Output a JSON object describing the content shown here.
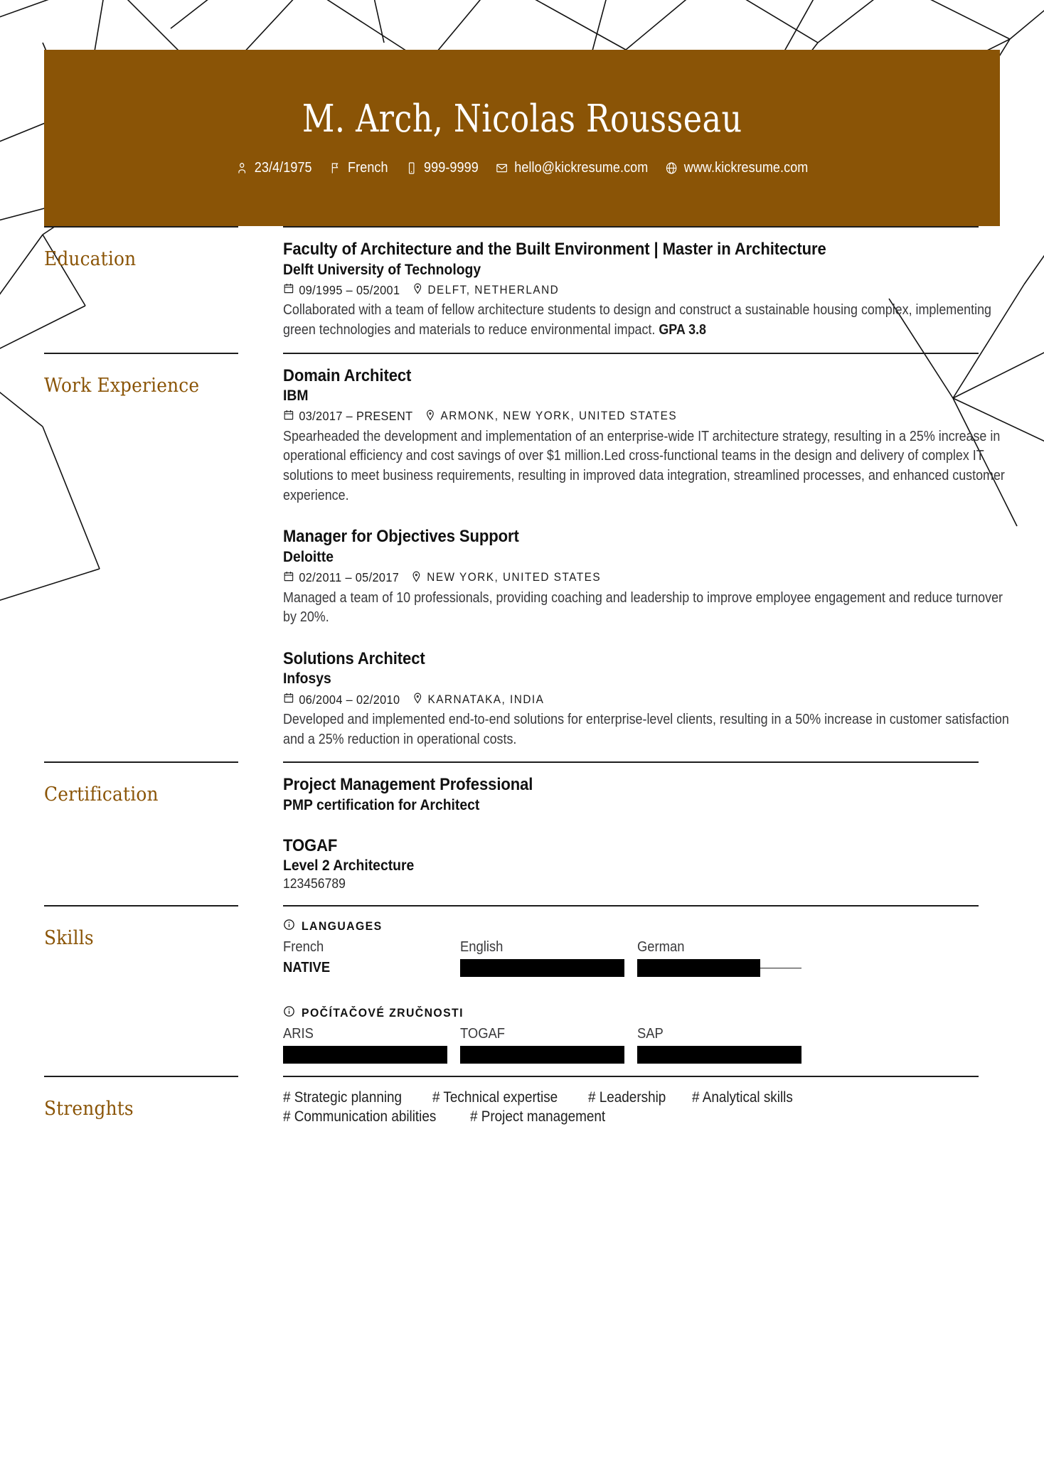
{
  "theme": {
    "brand_color": "#8a5406",
    "text_color": "#1a1a1a",
    "bar_color": "#000000"
  },
  "header": {
    "name": "M. Arch, Nicolas Rousseau",
    "contacts": [
      {
        "icon": "person-icon",
        "text": "23/4/1975"
      },
      {
        "icon": "flag-icon",
        "text": "French"
      },
      {
        "icon": "phone-icon",
        "text": "999-9999"
      },
      {
        "icon": "envelope-icon",
        "text": "hello@kickresume.com"
      },
      {
        "icon": "globe-icon",
        "text": "www.kickresume.com"
      }
    ]
  },
  "sections": [
    {
      "label": "Education",
      "entries": [
        {
          "title": "Faculty of Architecture and the Built Environment | Master in Architecture",
          "subtitle": "Delft University of Technology",
          "date": "09/1995 – 05/2001",
          "location": "DELFT, NETHERLAND",
          "description": "Collaborated with a team of fellow architecture students to design and construct a sustainable housing complex, implementing green technologies and materials to reduce environmental impact. ",
          "description_bold": "GPA 3.8"
        }
      ]
    },
    {
      "label": "Work Experience",
      "entries": [
        {
          "title": "Domain Architect",
          "subtitle": "IBM",
          "date": "03/2017 – PRESENT",
          "location": "ARMONK, NEW YORK, UNITED STATES",
          "description": "Spearheaded the development and implementation of an enterprise-wide IT architecture strategy, resulting in a 25% increase in operational efficiency and cost savings of over $1 million.Led cross-functional teams in the design and delivery of complex IT solutions to meet business requirements, resulting in improved data integration, streamlined processes, and enhanced customer experience.",
          "description_bold": ""
        },
        {
          "title": "Manager for Objectives Support",
          "subtitle": "Deloitte",
          "date": "02/2011 – 05/2017",
          "location": "NEW YORK, UNITED STATES",
          "description": "Managed a team of 10 professionals, providing coaching and leadership to improve employee engagement and reduce turnover by 20%.",
          "description_bold": ""
        },
        {
          "title": "Solutions Architect",
          "subtitle": "Infosys",
          "date": "06/2004 – 02/2010",
          "location": "KARNATAKA, INDIA",
          "description": "Developed and implemented end-to-end solutions for enterprise-level clients, resulting in a 50% increase in customer satisfaction and a 25% reduction in operational costs.",
          "description_bold": ""
        }
      ]
    },
    {
      "label": "Certification",
      "entries": [
        {
          "title": "Project Management Professional",
          "subtitle": "PMP certification for Architect",
          "date": "",
          "location": "",
          "description": "",
          "description_bold": ""
        },
        {
          "title": "TOGAF",
          "subtitle": "Level 2 Architecture",
          "plain": "123456789",
          "date": "",
          "location": "",
          "description": "",
          "description_bold": ""
        }
      ]
    }
  ],
  "skills": {
    "label": "Skills",
    "groups": [
      {
        "title": "LANGUAGES",
        "icon": "info-icon",
        "items": [
          {
            "name": "French",
            "level_text": "NATIVE",
            "level_pct": null
          },
          {
            "name": "English",
            "level_text": "",
            "level_pct": 100
          },
          {
            "name": "German",
            "level_text": "",
            "level_pct": 75
          }
        ]
      },
      {
        "title": "POČÍTAČOVÉ ZRUČNOSTI",
        "icon": "info-icon",
        "items": [
          {
            "name": "ARIS",
            "level_text": "",
            "level_pct": 100
          },
          {
            "name": "TOGAF",
            "level_text": "",
            "level_pct": 100
          },
          {
            "name": "SAP",
            "level_text": "",
            "level_pct": 100
          }
        ]
      }
    ]
  },
  "strengths": {
    "label": "Strenghts",
    "tags": [
      "# Strategic planning",
      "# Technical expertise",
      "# Leadership",
      "# Analytical skills",
      "# Communication abilities",
      "# Project management"
    ]
  }
}
